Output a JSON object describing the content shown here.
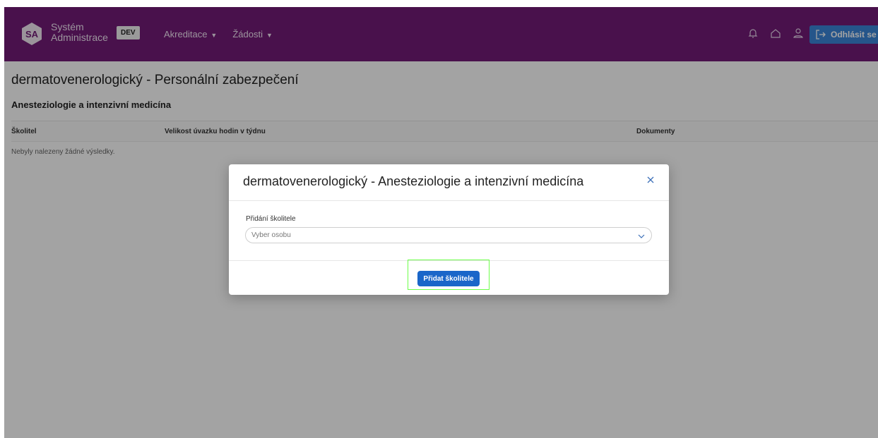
{
  "navbar": {
    "logo_text": "SA",
    "brand_line1": "Systém",
    "brand_line2": "Administrace",
    "env_badge": "DEV",
    "menu": [
      {
        "label": "Akreditace"
      },
      {
        "label": "Žádosti"
      }
    ],
    "icons": [
      "bell-icon",
      "home-icon",
      "user-icon"
    ],
    "logout_label": "Odhlásit se"
  },
  "page": {
    "title": "dermatovenerologický - Personální zabezpečení",
    "section_title": "Anesteziologie a intenzivní medicína",
    "table": {
      "columns": [
        "Školitel",
        "Velikost úvazku hodin v týdnu",
        "Dokumenty"
      ],
      "empty_message": "Nebyly nalezeny žádné výsledky."
    }
  },
  "modal": {
    "title": "dermatovenerologický - Anesteziologie a intenzivní medicína",
    "field_label": "Přidání školitele",
    "select_placeholder": "Vyber osobu",
    "submit_label": "Přidat školitele"
  },
  "colors": {
    "navbar_bg": "#731c78",
    "logout_bg": "#3b86d8",
    "primary_button": "#1a66c9",
    "focus_outline": "#6dff4a"
  }
}
